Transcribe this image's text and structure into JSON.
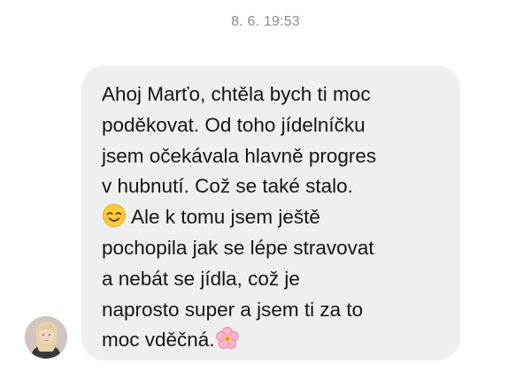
{
  "conversation": {
    "timestamp": "8. 6. 19:53"
  },
  "message": {
    "lines": [
      "Ahoj Marťo, chtěla bych ti moc",
      "poděkovat. Od toho jídelníčku",
      "jsem očekávala hlavně progres",
      "v hubnutí. Což se také stalo.",
      "Ale k tomu jsem ještě",
      "pochopila jak se lépe stravovat",
      "a nebát se jídla, což je",
      "naprosto super a jsem ti za to",
      "moc vděčná."
    ],
    "emojis": [
      "smiling-face-emoji",
      "cherry-blossom-emoji"
    ]
  },
  "colors": {
    "bubble": "#efefef",
    "text": "#151515",
    "timestamp": "#8a8d91"
  }
}
